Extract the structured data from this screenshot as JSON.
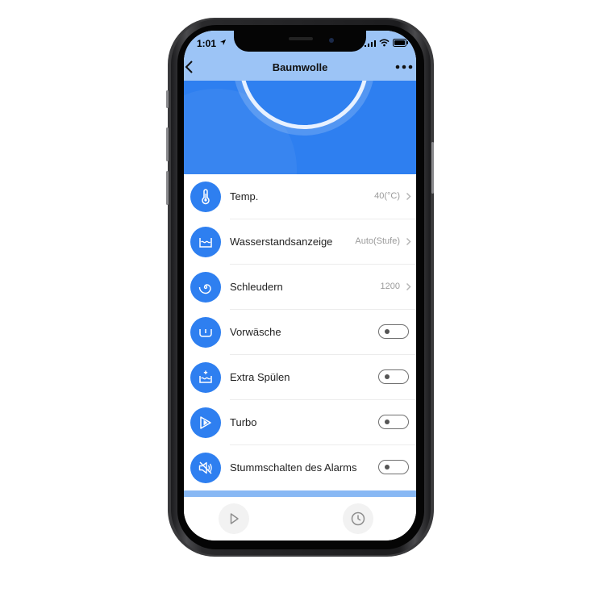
{
  "status_bar": {
    "time": "1:01"
  },
  "nav": {
    "title": "Baumwolle"
  },
  "settings": [
    {
      "label": "Temp.",
      "value": "40(°C)",
      "icon": "thermometer-icon",
      "type": "select"
    },
    {
      "label": "Wasserstandsanzeige",
      "value": "Auto(Stufe)",
      "icon": "water-level-icon",
      "type": "select"
    },
    {
      "label": "Schleudern",
      "value": "1200",
      "icon": "spin-icon",
      "type": "select"
    },
    {
      "label": "Vorwäsche",
      "icon": "prewash-icon",
      "type": "toggle",
      "on": false
    },
    {
      "label": "Extra Spülen",
      "icon": "extra-rinse-icon",
      "type": "toggle",
      "on": false
    },
    {
      "label": "Turbo",
      "icon": "turbo-icon",
      "type": "toggle",
      "on": false
    },
    {
      "label": "Stummschalten des Alarms",
      "icon": "mute-alarm-icon",
      "type": "toggle",
      "on": false
    }
  ],
  "bottom_bar": {
    "start_icon": "play-icon",
    "schedule_icon": "clock-icon"
  },
  "colors": {
    "accent": "#2e7ff0",
    "nav_bg": "#9cc4f6",
    "footer_band": "#88b8f4"
  }
}
